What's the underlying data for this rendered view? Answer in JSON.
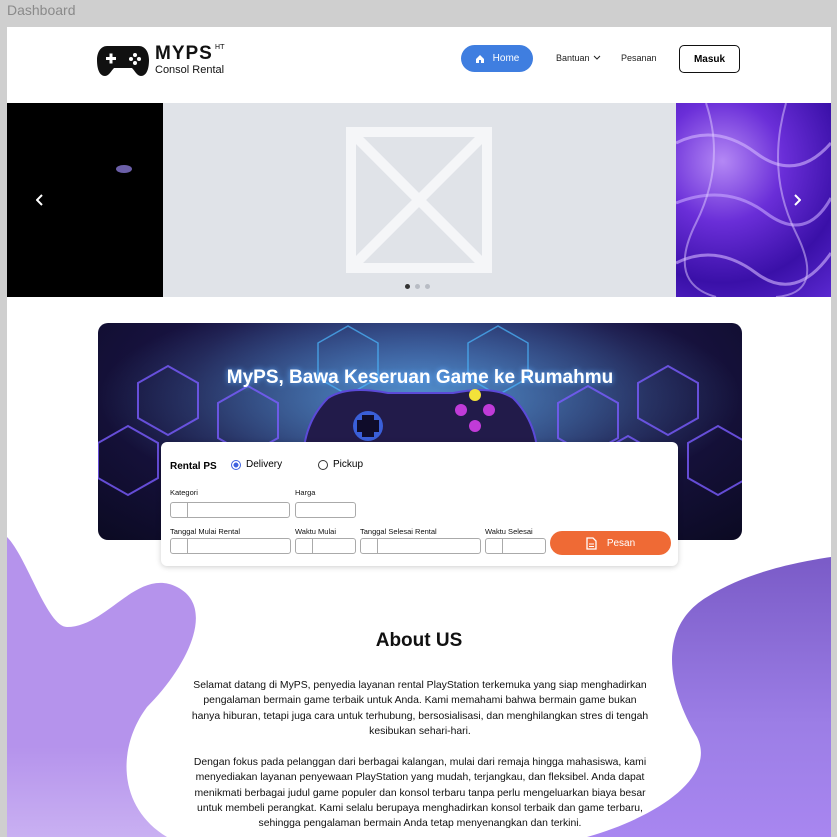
{
  "window": {
    "title": "Dashboard"
  },
  "header": {
    "logo_name": "MYPS",
    "logo_sup": "HT",
    "logo_sub": "Consol Rental",
    "nav": {
      "home": "Home",
      "help": "Bantuan",
      "orders": "Pesanan"
    },
    "login": "Masuk"
  },
  "carousel": {
    "slides": 3,
    "active": 0,
    "prev_icon": "chevron-left-icon",
    "next_icon": "chevron-right-icon"
  },
  "hero": {
    "title": "MyPS, Bawa Keseruan Game ke Rumahmu"
  },
  "booking": {
    "title": "Rental PS",
    "options": [
      "Delivery",
      "Pickup"
    ],
    "selected": "Delivery",
    "labels": {
      "category": "Kategori",
      "price": "Harga",
      "start_date": "Tanggal Mulai Rental",
      "start_time": "Waktu Mulai",
      "end_date": "Tanggal Selesai Rental",
      "end_time": "Waktu Selesai"
    },
    "submit": "Pesan"
  },
  "about": {
    "title": "About US",
    "p1_lines": [
      "Selamat datang di MyPS, penyedia layanan rental PlayStation terkemuka yang siap menghadirkan",
      "pengalaman bermain game terbaik untuk Anda. Kami memahami bahwa bermain game bukan",
      "hanya hiburan, tetapi juga cara untuk terhubung, bersosialisasi, dan menghilangkan stres di tengah",
      "kesibukan sehari-hari."
    ],
    "p2_lines": [
      "Dengan fokus pada pelanggan dari berbagai kalangan, mulai dari remaja hingga mahasiswa, kami",
      "menyediakan layanan penyewaan PlayStation yang mudah, terjangkau, dan fleksibel. Anda dapat",
      "menikmati berbagai judul game populer dan konsol terbaru tanpa perlu mengeluarkan biaya besar",
      "untuk membeli perangkat. Kami selalu berupaya menghadirkan konsol terbaik dan game terbaru,",
      "sehingga pengalaman bermain Anda tetap menyenangkan dan terkini."
    ]
  },
  "colors": {
    "primary": "#3f7ee0",
    "accent": "#ef6a35",
    "blob_left": "#b593ec",
    "blob_right": "#8a6ad8"
  }
}
